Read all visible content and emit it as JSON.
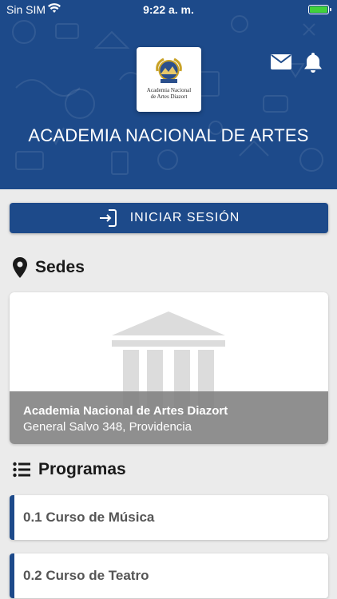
{
  "status_bar": {
    "carrier": "Sin SIM",
    "time": "9:22 a. m.",
    "battery_color": "#41d13b"
  },
  "header": {
    "logo": {
      "line1": "Academia Nacional",
      "line2": "de Artes Diazort"
    },
    "title": "ACADEMIA NACIONAL DE ARTES",
    "icons": [
      "mail-icon",
      "bell-icon"
    ],
    "background_color": "#1d4a8a"
  },
  "login": {
    "label": "INICIAR SESIÓN",
    "icon": "login-icon"
  },
  "sedes": {
    "title": "Sedes",
    "icon": "map-pin-icon",
    "items": [
      {
        "name": "Academia Nacional de Artes Diazort",
        "address": "General Salvo 348, Providencia"
      }
    ]
  },
  "programas": {
    "title": "Programas",
    "icon": "list-icon",
    "items": [
      {
        "label": "0.1 Curso de Música"
      },
      {
        "label": "0.2 Curso de Teatro"
      }
    ]
  }
}
